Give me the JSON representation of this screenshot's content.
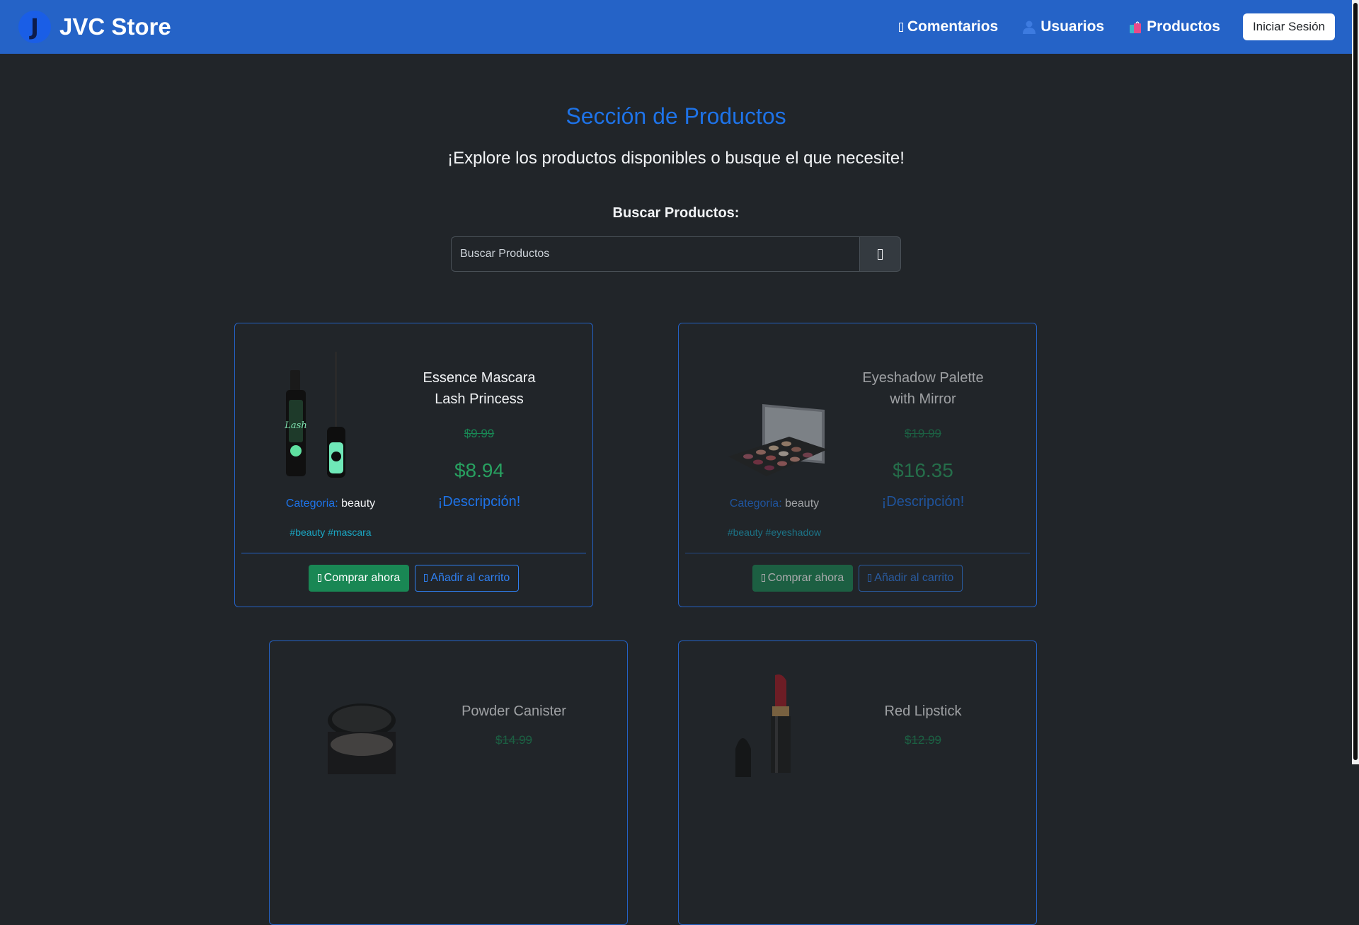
{
  "navbar": {
    "logo_letter": "J",
    "brand": "JVC Store",
    "links": [
      {
        "label": "Comentarios",
        "icon": "comment-icon"
      },
      {
        "label": "Usuarios",
        "icon": "user-icon"
      },
      {
        "label": "Productos",
        "icon": "shopping-bags-icon"
      }
    ],
    "login_label": "Iniciar Sesión"
  },
  "header": {
    "title": "Sección de Productos",
    "subtitle": "¡Explore los productos disponibles o busque el que necesite!"
  },
  "search": {
    "label": "Buscar Productos:",
    "placeholder": "Buscar Productos",
    "button_icon": "search-icon"
  },
  "card_labels": {
    "category_label": "Categoria:",
    "description_link": "¡Descripción!",
    "buy_label": "Comprar ahora",
    "cart_label": "Añadir al carrito"
  },
  "products": [
    {
      "title": "Essence Mascara Lash Princess",
      "old_price": "$9.99",
      "price": "$8.94",
      "category": "beauty",
      "tags": "#beauty #mascara",
      "image": "mascara-image"
    },
    {
      "title": "Eyeshadow Palette with Mirror",
      "old_price": "$19.99",
      "price": "$16.35",
      "category": "beauty",
      "tags": "#beauty #eyeshadow",
      "image": "eyeshadow-palette-image"
    },
    {
      "title": "Powder Canister",
      "old_price": "$14.99",
      "image": "powder-canister-image"
    },
    {
      "title": "Red Lipstick",
      "old_price": "$12.99",
      "image": "red-lipstick-image"
    }
  ],
  "colors": {
    "navbar": "#2563c7",
    "background": "#212529",
    "accent_blue": "#1e73e8",
    "price_green": "#198754"
  }
}
